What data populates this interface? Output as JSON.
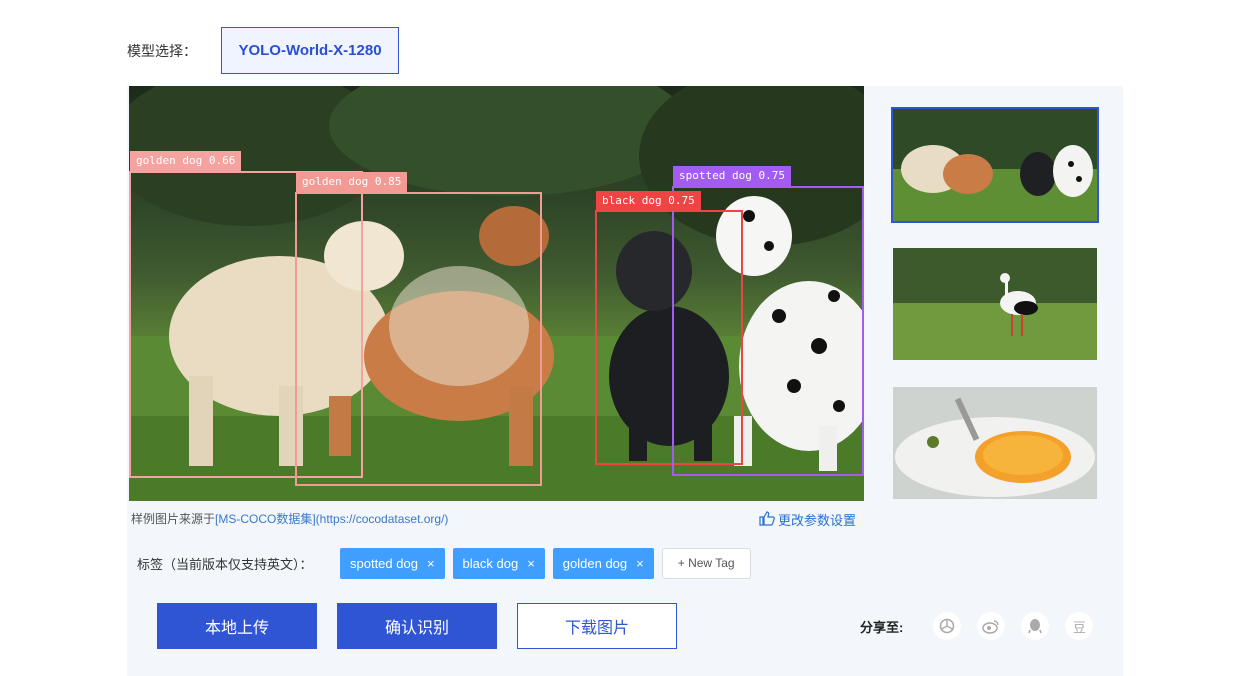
{
  "model": {
    "label": "模型选择：",
    "selected": "YOLO-World-X-1280"
  },
  "detections": [
    {
      "label": "golden dog 0.66",
      "color": "#f4a3a0"
    },
    {
      "label": "golden dog 0.85",
      "color": "#f29a93"
    },
    {
      "label": "black dog 0.75",
      "color": "#ee4444"
    },
    {
      "label": "spotted dog 0.75",
      "color": "#a35cf2"
    }
  ],
  "source": {
    "prefix": "样例图片来源于",
    "link": "[MS-COCO数据集](https://cocodataset.org/)"
  },
  "params_link": "更改参数设置",
  "tags": {
    "label": "标签（当前版本仅支持英文）：",
    "items": [
      "spotted dog",
      "black dog",
      "golden dog"
    ],
    "remove_glyph": "×",
    "new_tag": "+ New Tag"
  },
  "buttons": {
    "upload": "本地上传",
    "recognize": "确认识别",
    "download": "下载图片"
  },
  "share": {
    "label": "分享至:",
    "icons": [
      "wechat-moments-icon",
      "weibo-icon",
      "qq-icon",
      "douban-icon"
    ],
    "douban_glyph": "豆"
  },
  "colors": {
    "primary": "#2f55d4",
    "tag": "#409eff",
    "panel": "#f3f6fb"
  }
}
